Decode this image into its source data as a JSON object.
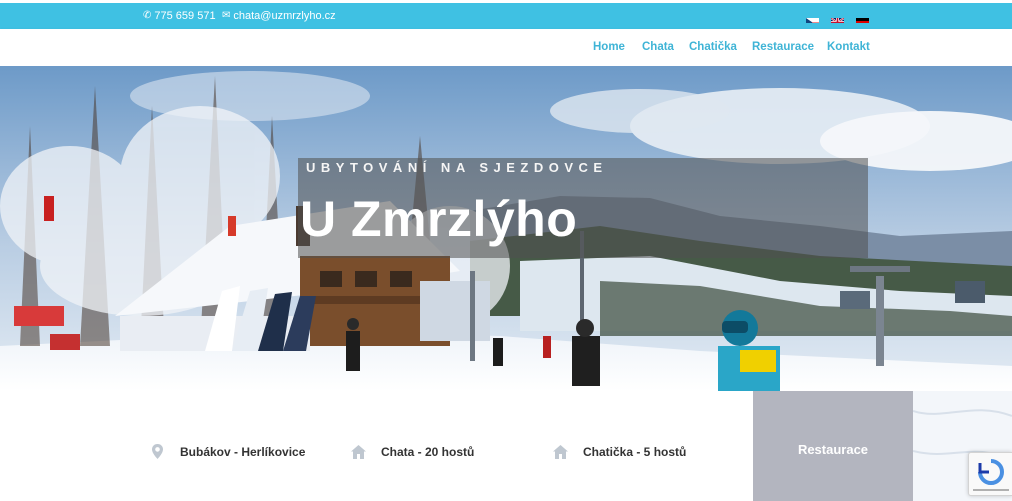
{
  "topbar": {
    "phone": "775 659 571",
    "email": "chata@uzmrzlyho.cz",
    "phone_icon": "phone-icon",
    "email_icon": "envelope-icon",
    "languages": [
      "cs",
      "en",
      "de"
    ]
  },
  "nav": {
    "items": [
      "Home",
      "Chata",
      "Chatička",
      "Restaurace",
      "Kontakt"
    ]
  },
  "hero": {
    "subtitle": "UBYTOVÁNÍ NA SJEZDOVCE",
    "title": "U Zmrzlýho"
  },
  "info": {
    "items": [
      {
        "icon": "map-pin-icon",
        "label": "Bubákov - Herlíkovice"
      },
      {
        "icon": "home-icon",
        "label": "Chata - 20 hostů"
      },
      {
        "icon": "home-icon",
        "label": "Chatička - 5 hostů"
      }
    ],
    "restaurant_button": "Restaurace"
  },
  "colors": {
    "accent": "#3fc1e3",
    "nav_text": "#3fb4d6",
    "restaurant_box": "#b3b5bf",
    "info_icon": "#bfc7d0"
  }
}
